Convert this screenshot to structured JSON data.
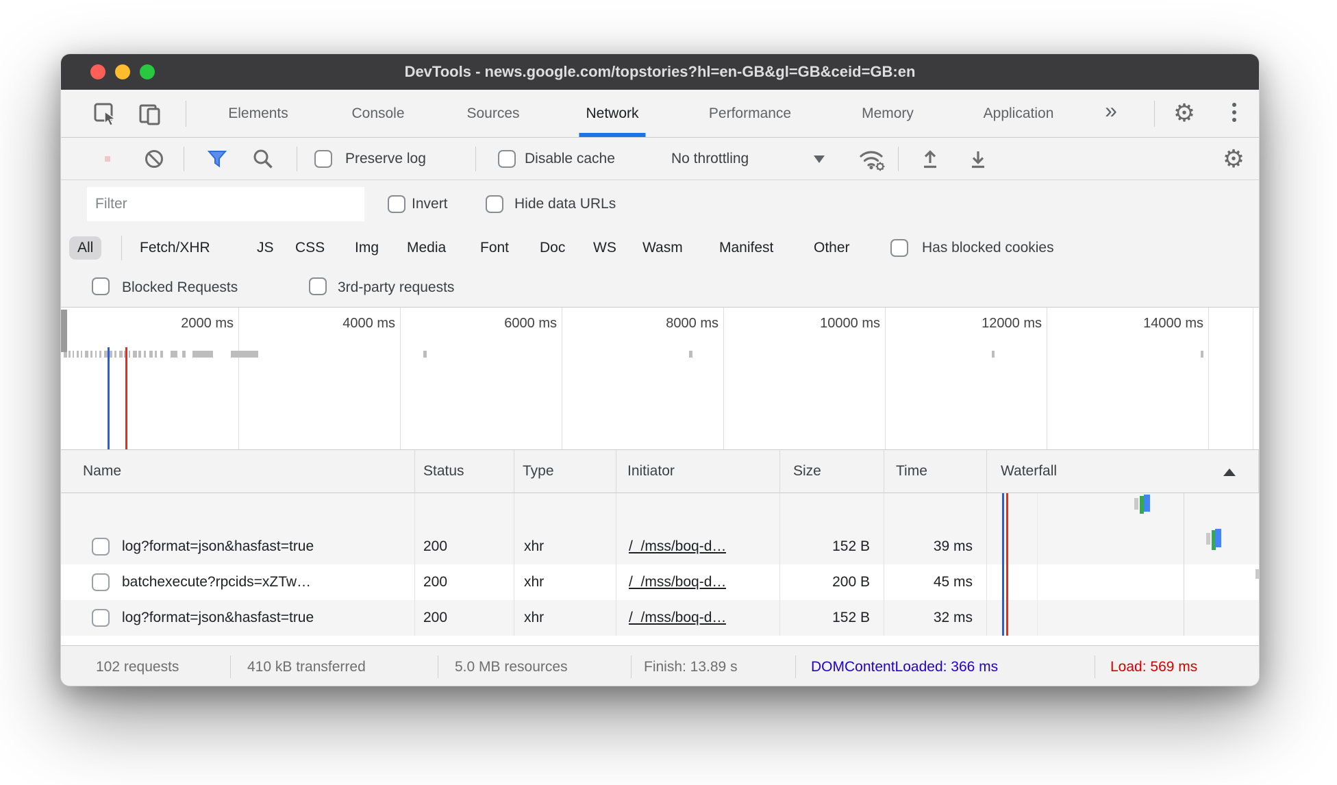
{
  "window": {
    "title": "DevTools - news.google.com/topstories?hl=en-GB&gl=GB&ceid=GB:en"
  },
  "tabs": {
    "items": [
      {
        "label": "Elements"
      },
      {
        "label": "Console"
      },
      {
        "label": "Sources"
      },
      {
        "label": "Network"
      },
      {
        "label": "Performance"
      },
      {
        "label": "Memory"
      },
      {
        "label": "Application"
      }
    ],
    "selected": "Network",
    "more_label": "»"
  },
  "network_toolbar": {
    "preserve_log_label": "Preserve log",
    "disable_cache_label": "Disable cache",
    "throttling_value": "No throttling"
  },
  "filter_bar": {
    "placeholder": "Filter",
    "invert_label": "Invert",
    "hide_data_urls_label": "Hide data URLs"
  },
  "type_filters": {
    "selected": "All",
    "pills": [
      {
        "label": "All"
      },
      {
        "label": "Fetch/XHR"
      },
      {
        "label": "JS"
      },
      {
        "label": "CSS"
      },
      {
        "label": "Img"
      },
      {
        "label": "Media"
      },
      {
        "label": "Font"
      },
      {
        "label": "Doc"
      },
      {
        "label": "WS"
      },
      {
        "label": "Wasm"
      },
      {
        "label": "Manifest"
      },
      {
        "label": "Other"
      }
    ],
    "has_blocked_cookies_label": "Has blocked cookies"
  },
  "request_filters": {
    "blocked_requests_label": "Blocked Requests",
    "third_party_label": "3rd-party requests"
  },
  "timeline": {
    "labels": [
      "2000 ms",
      "4000 ms",
      "6000 ms",
      "8000 ms",
      "10000 ms",
      "12000 ms",
      "14000 ms"
    ]
  },
  "requests_table": {
    "columns": [
      "Name",
      "Status",
      "Type",
      "Initiator",
      "Size",
      "Time",
      "Waterfall"
    ],
    "rows": [
      {
        "name": "log?format=json&hasfast=true",
        "status": "200",
        "type": "xhr",
        "initiator": "/_/mss/boq-d…",
        "size": "152 B",
        "time": "39 ms"
      },
      {
        "name": "batchexecute?rpcids=xZTw…",
        "status": "200",
        "type": "xhr",
        "initiator": "/_/mss/boq-d…",
        "size": "200 B",
        "time": "45 ms"
      },
      {
        "name": "log?format=json&hasfast=true",
        "status": "200",
        "type": "xhr",
        "initiator": "/_/mss/boq-d…",
        "size": "152 B",
        "time": "32 ms"
      }
    ]
  },
  "footer": {
    "summary": [
      {
        "text": "102 requests"
      },
      {
        "text": "410 kB transferred"
      },
      {
        "text": "5.0 MB resources"
      },
      {
        "text": "Finish: 13.89 s"
      },
      {
        "text": "DOMContentLoaded: 366 ms"
      },
      {
        "text": "Load: 569 ms"
      }
    ]
  },
  "colors": {
    "accent_blue": "#1a73e8",
    "record_red": "#d93025",
    "dom_content_loaded_blue": "#2200cc",
    "load_red": "#d40000",
    "waterfall_green": "#34a853",
    "waterfall_blue": "#4285f4",
    "traffic_red": "#ff5f57",
    "traffic_yellow": "#febc2e",
    "traffic_green": "#28c840"
  }
}
